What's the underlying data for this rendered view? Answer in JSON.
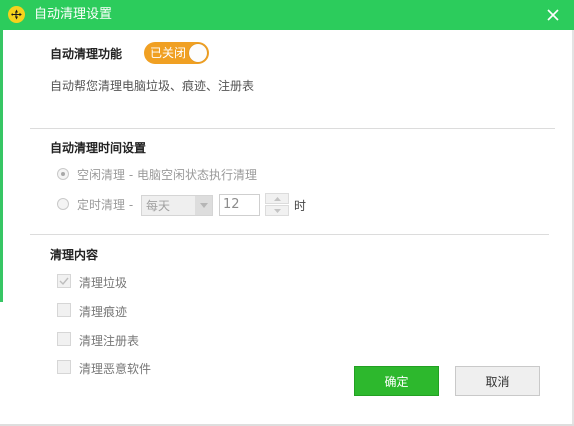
{
  "window": {
    "title": "自动清理设置"
  },
  "auto_clean": {
    "label": "自动清理功能",
    "toggle_label": "已关闭",
    "enabled": false,
    "description": "自动帮您清理电脑垃圾、痕迹、注册表"
  },
  "schedule": {
    "heading": "自动清理时间设置",
    "idle_option": "空闲清理 - 电脑空闲状态执行清理",
    "timed_option": "定时清理 -",
    "frequency_value": "每天",
    "hour_value": "12",
    "hour_unit": "时"
  },
  "content": {
    "heading": "清理内容",
    "items": [
      {
        "label": "清理垃圾",
        "checked": true
      },
      {
        "label": "清理痕迹",
        "checked": false
      },
      {
        "label": "清理注册表",
        "checked": false
      },
      {
        "label": "清理恶意软件",
        "checked": false
      }
    ]
  },
  "buttons": {
    "ok": "确定",
    "cancel": "取消"
  },
  "colors": {
    "titlebar": "#2ccc5c",
    "toggle_off": "#f0a023",
    "ok_button": "#2db82d"
  }
}
